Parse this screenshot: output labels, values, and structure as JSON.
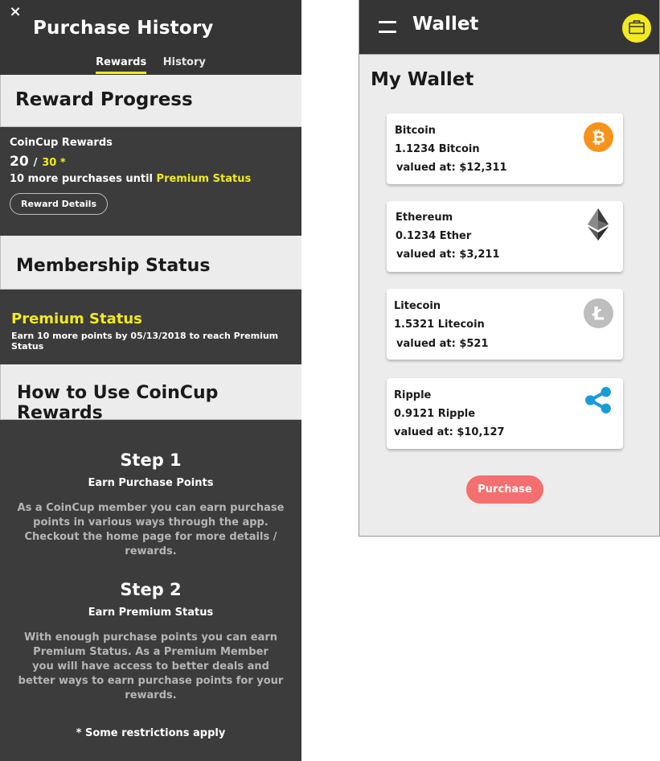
{
  "purchase_history": {
    "title": "Purchase History",
    "close_label": "×",
    "tabs": [
      {
        "label": "Rewards",
        "active": true
      },
      {
        "label": "History",
        "active": false
      }
    ],
    "reward_progress": {
      "heading": "Reward Progress",
      "label": "CoinCup Rewards",
      "current": "20",
      "slash": "/",
      "goal": "30 *",
      "until_prefix": "10 more purchases until",
      "until_highlight": "Premium Status",
      "details_button": "Reward Details"
    },
    "membership": {
      "heading": "Membership Status",
      "status": "Premium Status",
      "description": "Earn 10 more points by 05/13/2018 to reach Premium Status"
    },
    "how_to": {
      "heading": "How to Use CoinCup Rewards",
      "steps": [
        {
          "title": "Step 1",
          "subtitle": "Earn Purchase Points",
          "lines": [
            "As a CoinCup member you can earn purchase",
            "points in various ways through the app.",
            "Checkout the home page for more details / rewards."
          ]
        },
        {
          "title": "Step 2",
          "subtitle": "Earn Premium Status",
          "lines": [
            "With enough purchase points you can earn",
            "Premium Status. As a Premium Member",
            "you will have access to better deals and",
            "better ways to earn purchase points for your rewards."
          ]
        }
      ],
      "restrictions": "* Some restrictions apply"
    }
  },
  "wallet": {
    "title": "Wallet",
    "heading": "My Wallet",
    "coins": [
      {
        "name": "Bitcoin",
        "amount": "1.1234 Bitcoin",
        "value": "valued at: $12,311",
        "icon": "bitcoin-icon",
        "color": "#f7931a"
      },
      {
        "name": "Ethereum",
        "amount": "0.1234 Ether",
        "value": "valued at: $3,211",
        "icon": "ethereum-icon",
        "color": "#3c3c3d"
      },
      {
        "name": "Litecoin",
        "amount": "1.5321 Litecoin",
        "value": "valued at: $521",
        "icon": "litecoin-icon",
        "color": "#bebebe"
      },
      {
        "name": "Ripple",
        "amount": "0.9121 Ripple",
        "value": "valued at: $10,127",
        "icon": "ripple-icon",
        "color": "#1a9bd7"
      }
    ],
    "purchase_button": "Purchase"
  },
  "colors": {
    "accent_yellow": "#f2ea1e",
    "dark_panel": "#3c3c3c",
    "purchase_button": "#f46f6f"
  }
}
